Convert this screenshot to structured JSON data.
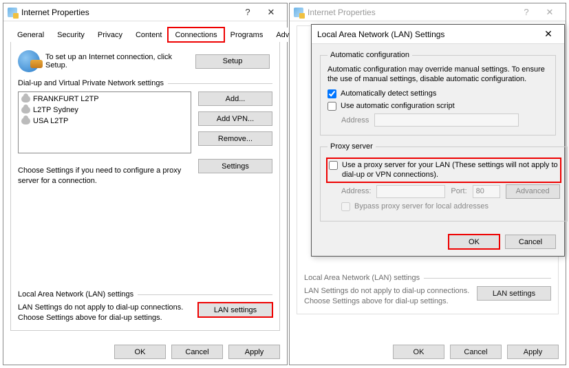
{
  "left": {
    "title": "Internet Properties",
    "tabs": [
      "General",
      "Security",
      "Privacy",
      "Content",
      "Connections",
      "Programs",
      "Advanced"
    ],
    "active_tab": 4,
    "setup_text": "To set up an Internet connection, click Setup.",
    "setup_btn": "Setup",
    "dialup_label": "Dial-up and Virtual Private Network settings",
    "conn_items": [
      "FRANKFURT L2TP",
      "L2TP Sydney",
      "USA L2TP"
    ],
    "btn_add": "Add...",
    "btn_addvpn": "Add VPN...",
    "btn_remove": "Remove...",
    "btn_settings": "Settings",
    "choose_text": "Choose Settings if you need to configure a proxy server for a connection.",
    "lan_label": "Local Area Network (LAN) settings",
    "lan_text": "LAN Settings do not apply to dial-up connections. Choose Settings above for dial-up settings.",
    "lan_btn": "LAN settings",
    "ok": "OK",
    "cancel": "Cancel",
    "apply": "Apply",
    "help": "?",
    "close": "✕"
  },
  "right": {
    "title": "Internet Properties",
    "lan_label": "Local Area Network (LAN) settings",
    "lan_text": "LAN Settings do not apply to dial-up connections. Choose Settings above for dial-up settings.",
    "lan_btn": "LAN settings",
    "ok": "OK",
    "cancel": "Cancel",
    "apply": "Apply",
    "help": "?",
    "close": "✕"
  },
  "modal": {
    "title": "Local Area Network (LAN) Settings",
    "close": "✕",
    "auto_legend": "Automatic configuration",
    "auto_desc": "Automatic configuration may override manual settings.  To ensure the use of manual settings, disable automatic configuration.",
    "auto_detect": "Automatically detect settings",
    "auto_detect_checked": true,
    "auto_script": "Use automatic configuration script",
    "auto_script_checked": false,
    "address_label": "Address",
    "proxy_legend": "Proxy server",
    "proxy_use": "Use a proxy server for your LAN (These settings will not apply to dial-up or VPN connections).",
    "proxy_use_checked": false,
    "proxy_addr_label": "Address:",
    "proxy_port_label": "Port:",
    "proxy_port_value": "80",
    "advanced": "Advanced",
    "bypass": "Bypass proxy server for local addresses",
    "ok": "OK",
    "cancel": "Cancel"
  }
}
